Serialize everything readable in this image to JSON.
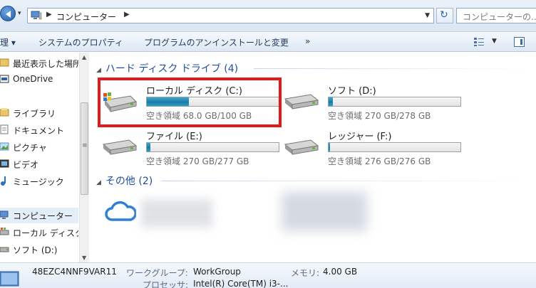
{
  "address": {
    "path": "コンピューター",
    "search_placeholder": "コンピューターの..."
  },
  "toolbar": {
    "organize": "理 ▾",
    "properties": "システムのプロパティ",
    "uninstall": "プログラムのアンインストールと変更",
    "more": "»"
  },
  "nav": {
    "items": [
      {
        "label": "最近表示した場所",
        "icon": "recent-places-icon"
      },
      {
        "label": "OneDrive",
        "icon": "onedrive-icon"
      },
      {
        "label": "ライブラリ",
        "icon": "library-icon"
      },
      {
        "label": "ドキュメント",
        "icon": "documents-icon"
      },
      {
        "label": "ピクチャ",
        "icon": "pictures-icon"
      },
      {
        "label": "ビデオ",
        "icon": "videos-icon"
      },
      {
        "label": "ミュージック",
        "icon": "music-icon"
      },
      {
        "label": "コンピューター",
        "icon": "computer-icon"
      },
      {
        "label": "ローカル ディスク",
        "icon": "local-disk-icon"
      },
      {
        "label": "ソフト (D:)",
        "icon": "drive-icon"
      }
    ]
  },
  "groups": {
    "hdd": "ハード ディスク ドライブ (4)",
    "other": "その他 (2)"
  },
  "drives": [
    {
      "name": "ローカル ディスク (C:)",
      "free": "空き領域 68.0 GB/100 GB",
      "used_fraction": 0.32
    },
    {
      "name": "ソフト (D:)",
      "free": "空き領域 270 GB/278 GB",
      "used_fraction": 0.03
    },
    {
      "name": "ファイル (E:)",
      "free": "空き領域 270 GB/277 GB",
      "used_fraction": 0.025
    },
    {
      "name": "レッジャー (F:)",
      "free": "空き領域 276 GB/276 GB",
      "used_fraction": 0.01
    }
  ],
  "details": {
    "computer_name": "48EZC4NNF9VAR11",
    "workgroup_label": "ワークグループ:",
    "workgroup_value": "WorkGroup",
    "memory_label": "メモリ:",
    "memory_value": "4.00 GB",
    "processor_label": "プロセッサ:",
    "processor_value": "Intel(R) Core(TM) i3-..."
  },
  "colors": {
    "accent": "#1e4d9a",
    "highlight": "#e21a1a",
    "bar_fill": "#1b7ba9"
  }
}
